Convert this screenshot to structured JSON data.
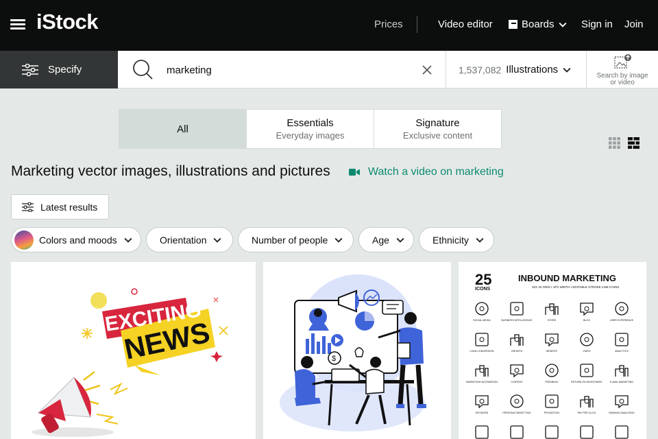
{
  "brand": {
    "logo": "iStock"
  },
  "nav": {
    "prices": "Prices",
    "video_editor": "Video editor",
    "boards": "Boards",
    "sign_in": "Sign in",
    "join": "Join"
  },
  "search": {
    "specify": "Specify",
    "query": "marketing",
    "count": "1,537,082",
    "type": "Illustrations",
    "search_by_image_line1": "Search by image",
    "search_by_image_line2": "or video"
  },
  "tabs": [
    {
      "title": "All",
      "sub": ""
    },
    {
      "title": "Essentials",
      "sub": "Everyday images"
    },
    {
      "title": "Signature",
      "sub": "Exclusive content"
    }
  ],
  "page_title": "Marketing vector images, illustrations and pictures",
  "watch_link": "Watch a video on marketing",
  "latest_results": "Latest results",
  "filters": [
    "Colors and moods",
    "Orientation",
    "Number of people",
    "Age",
    "Ethnicity"
  ],
  "cards": {
    "news": {
      "line1": "EXCITING",
      "line2": "NEWS"
    },
    "inbound": {
      "count": "25",
      "count_label": "ICONS",
      "title": "INBOUND MARKETING",
      "subtitle": "32X 32 GRID • 1PX WIDTH • EDITABLE STROKE LINE ICONS",
      "icons": [
        "SOCIAL MEDIA",
        "BUSINESS INTELLIGENCE",
        "STORE",
        "BLOG",
        "USER EXPERIENCE",
        "LOAN CONVERSION",
        "GROWTH",
        "WEBSITE",
        "VIDEO",
        "ANALYTICS",
        "MARKETING AUTOMATION",
        "CONTENT",
        "FEEDBACK",
        "RETURN ON INVESTMENT",
        "E-MAIL MARKETING",
        "KEYWORD",
        "PERSONA TARGETTING",
        "PROMOTION",
        "PAY PER CLICK",
        "RANKING ANALYZING"
      ]
    }
  },
  "colors": {
    "accent_green": "#0d8a6e",
    "nav_bg": "#0c0d0d",
    "specify_bg": "#333636",
    "page_bg": "#e4e9e8"
  }
}
